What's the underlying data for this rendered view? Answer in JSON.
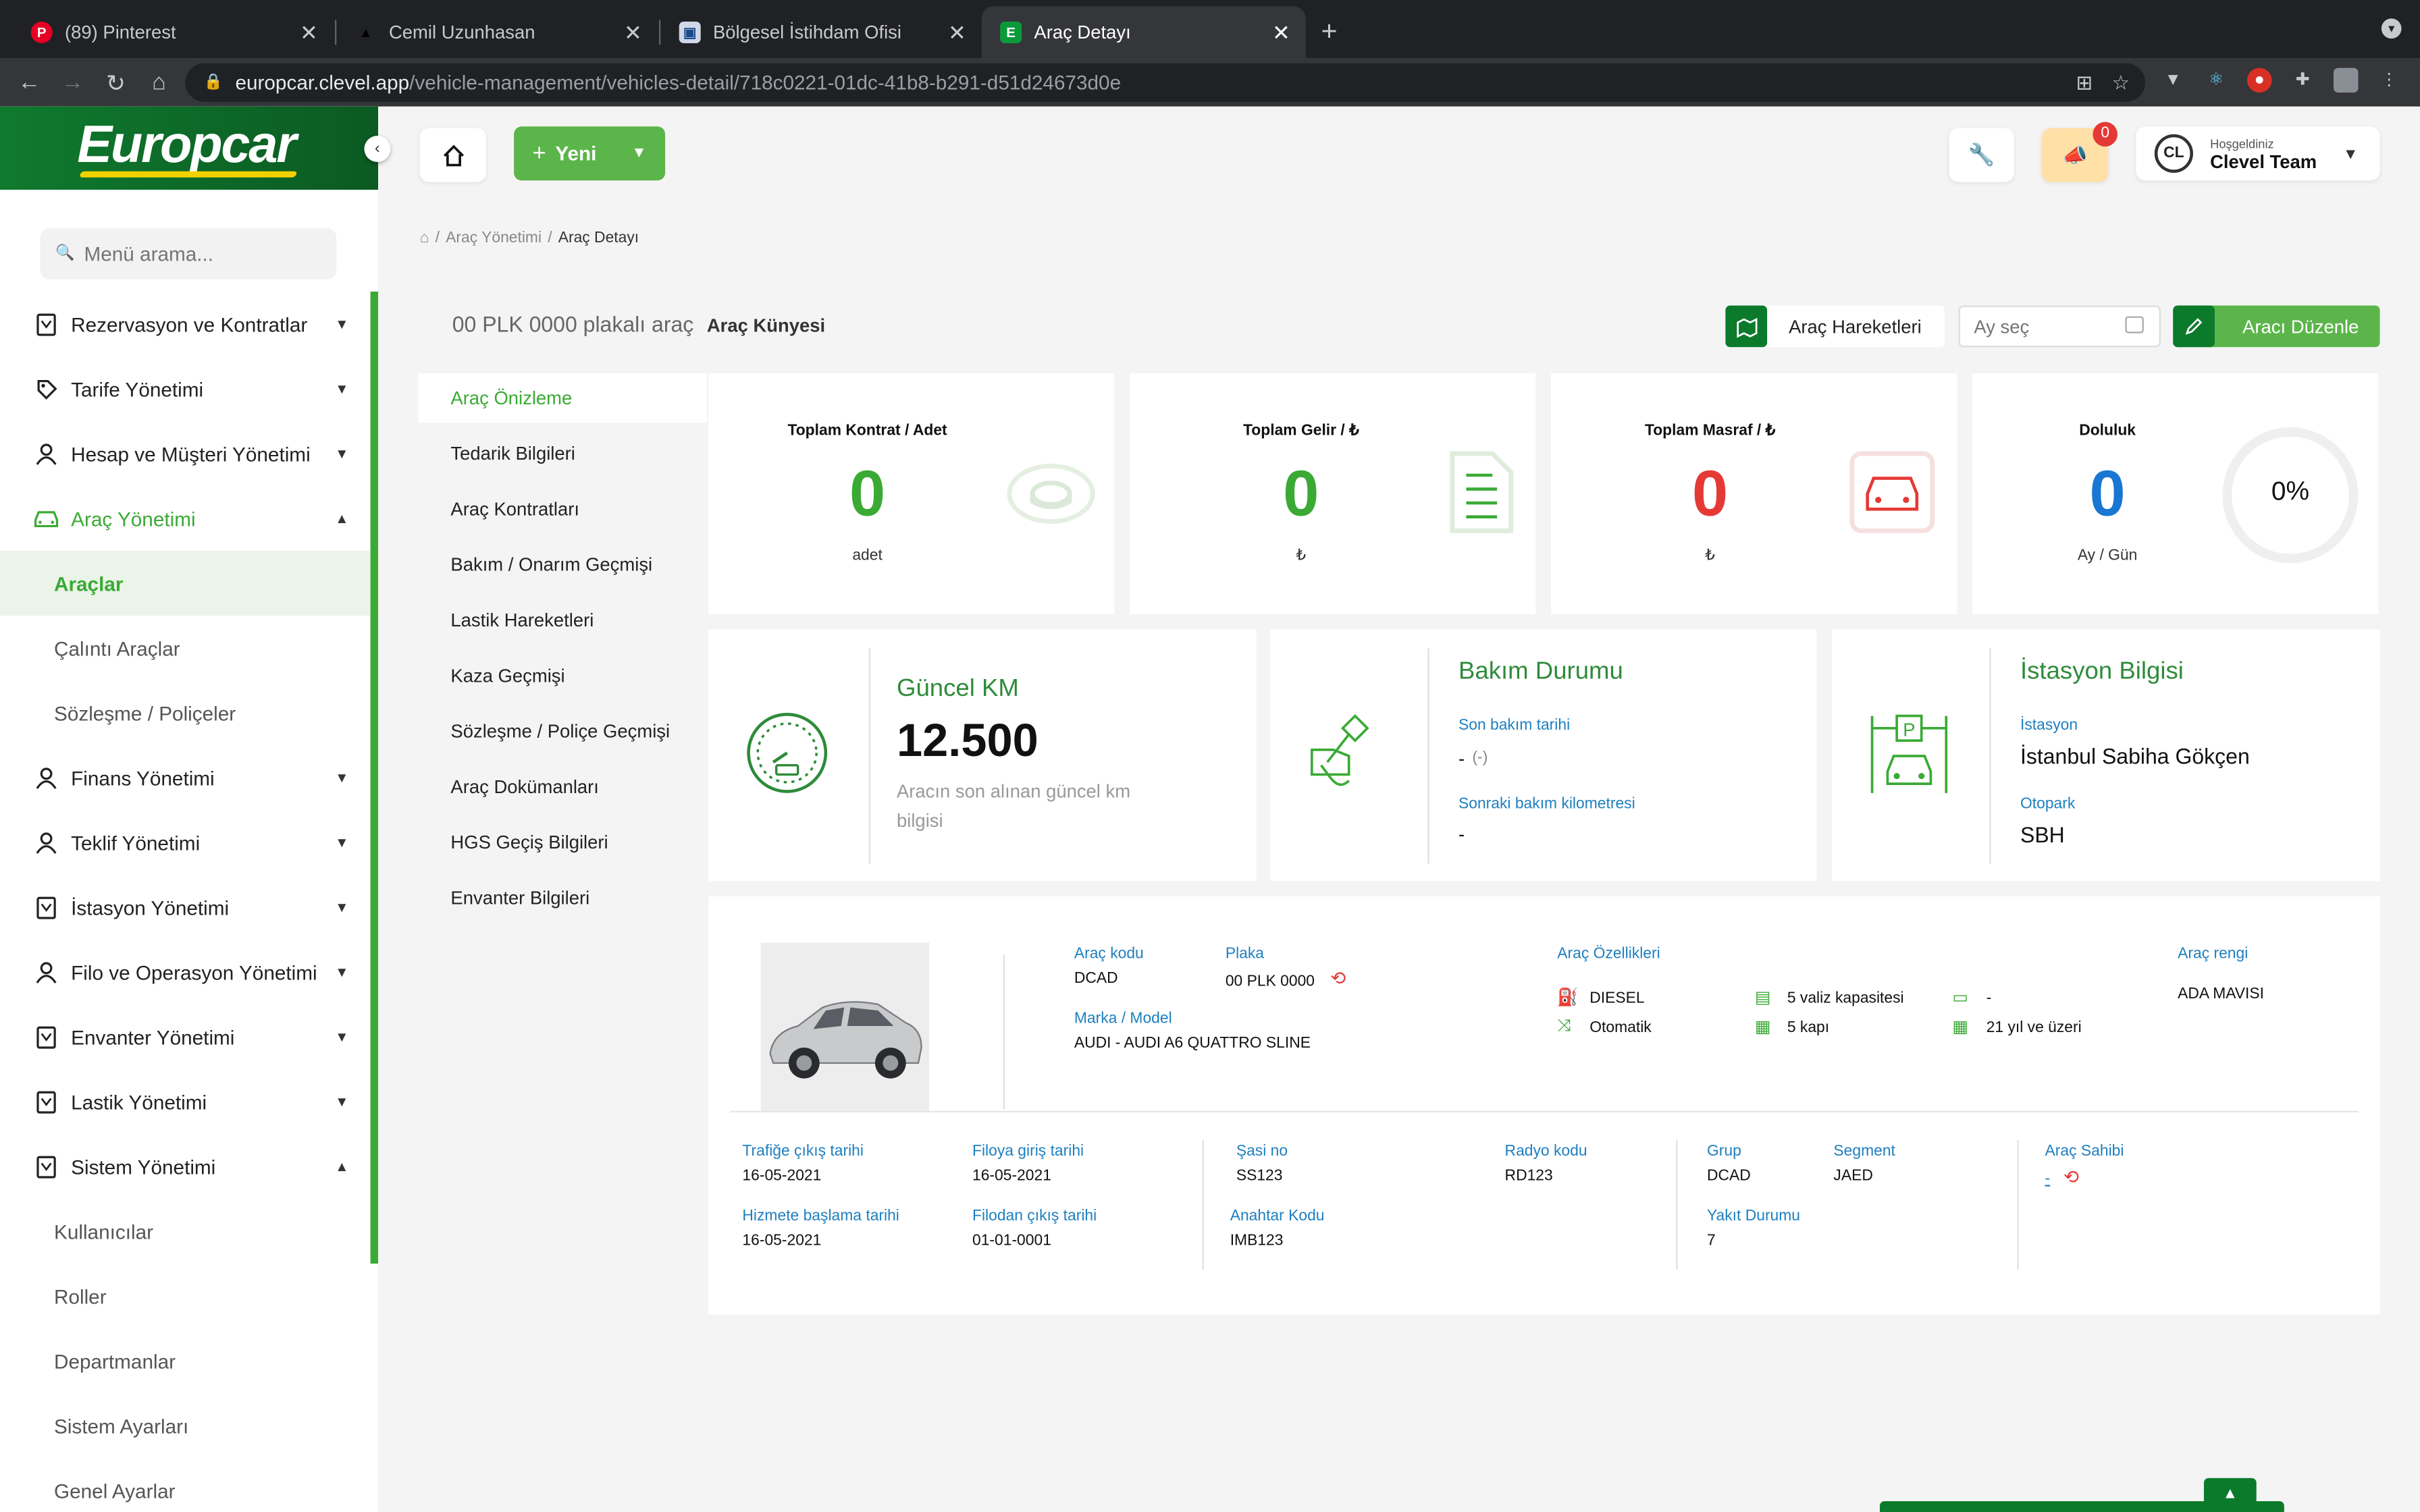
{
  "browser": {
    "tabs": [
      {
        "title": "(89) Pinterest"
      },
      {
        "title": "Cemil Uzunhasan"
      },
      {
        "title": "Bölgesel İstihdam Ofisi"
      },
      {
        "title": "Araç Detayı"
      }
    ],
    "url_domain": "europcar.clevel.app",
    "url_path": "/vehicle-management/vehicles-detail/718c0221-01dc-41b8-b291-d51d24673d0e"
  },
  "brand": {
    "logo": "Europcar",
    "primary": "#0b7a2b",
    "accent": "#5cb54a",
    "logo_stripe": "#f2d100"
  },
  "sidebar": {
    "search_placeholder": "Menü arama...",
    "items": [
      {
        "label": "Rezervasyon ve Kontratlar",
        "icon": "contract-icon",
        "chevron": "down"
      },
      {
        "label": "Tarife Yönetimi",
        "icon": "tag-icon",
        "chevron": "down"
      },
      {
        "label": "Hesap ve Müşteri Yönetimi",
        "icon": "user-icon",
        "chevron": "down"
      },
      {
        "label": "Araç Yönetimi",
        "icon": "car-icon",
        "chevron": "up"
      },
      {
        "label": "Araçlar"
      },
      {
        "label": "Çalıntı Araçlar"
      },
      {
        "label": "Sözleşme / Poliçeler"
      },
      {
        "label": "Finans Yönetimi",
        "icon": "user-icon",
        "chevron": "down"
      },
      {
        "label": "Teklif Yönetimi",
        "icon": "user-icon",
        "chevron": "down"
      },
      {
        "label": "İstasyon Yönetimi",
        "icon": "contract-icon",
        "chevron": "down"
      },
      {
        "label": "Filo ve Operasyon Yönetimi",
        "icon": "user-icon",
        "chevron": "down"
      },
      {
        "label": "Envanter Yönetimi",
        "icon": "contract-icon",
        "chevron": "down"
      },
      {
        "label": "Lastik Yönetimi",
        "icon": "contract-icon",
        "chevron": "down"
      },
      {
        "label": "Sistem Yönetimi",
        "icon": "contract-icon",
        "chevron": "up"
      },
      {
        "label": "Kullanıcılar"
      },
      {
        "label": "Roller"
      },
      {
        "label": "Departmanlar"
      },
      {
        "label": "Sistem Ayarları"
      },
      {
        "label": "Genel Ayarlar"
      }
    ]
  },
  "header": {
    "new_button": "Yeni",
    "notification_count": "0",
    "user_greeting": "Hoşgeldiniz",
    "user_name": "Clevel Team",
    "user_initials": "CL"
  },
  "breadcrumb": {
    "items": [
      "Araç Yönetimi",
      "Araç Detayı"
    ]
  },
  "page": {
    "title": "00 PLK 0000 plakalı araç",
    "subtitle": "Araç Künyesi",
    "movements_button": "Araç Hareketleri",
    "month_placeholder": "Ay seç",
    "edit_button": "Aracı Düzenle"
  },
  "detail_nav": {
    "items": [
      "Araç Önizleme",
      "Tedarik Bilgileri",
      "Araç Kontratları",
      "Bakım / Onarım Geçmişi",
      "Lastik Hareketleri",
      "Kaza Geçmişi",
      "Sözleşme / Poliçe Geçmişi",
      "Araç Dokümanları",
      "HGS Geçiş Bilgileri",
      "Envanter Bilgileri"
    ]
  },
  "stats": [
    {
      "label": "Toplam Kontrat / Adet",
      "value": "0",
      "unit": "adet",
      "color": "#3aaa35"
    },
    {
      "label": "Toplam Gelir / ₺",
      "value": "0",
      "unit": "₺",
      "color": "#3aaa35"
    },
    {
      "label": "Toplam Masraf / ₺",
      "value": "0",
      "unit": "₺",
      "color": "#e53935"
    },
    {
      "label": "Doluluk",
      "value": "0",
      "unit": "Ay / Gün",
      "color": "#1976d2",
      "percent": "0%"
    }
  ],
  "km_card": {
    "title": "Güncel KM",
    "value": "12.500",
    "desc": "Aracın son alınan güncel km bilgisi"
  },
  "maintenance_card": {
    "title": "Bakım Durumu",
    "last_label": "Son bakım tarihi",
    "last_value": "-",
    "last_extra": "(-)",
    "next_label": "Sonraki bakım kilometresi",
    "next_value": "-"
  },
  "station_card": {
    "title": "İstasyon Bilgisi",
    "station_label": "İstasyon",
    "station_value": "İstanbul Sabiha Gökçen",
    "park_label": "Otopark",
    "park_value": "SBH"
  },
  "vehicle": {
    "code_label": "Araç kodu",
    "code": "DCAD",
    "plate_label": "Plaka",
    "plate": "00 PLK 0000",
    "brand_label": "Marka / Model",
    "brand": "AUDI - AUDI A6 QUATTRO SLINE",
    "features_label": "Araç Özellikleri",
    "fuel": "DIESEL",
    "transmission": "Otomatik",
    "luggage": "5 valiz kapasitesi",
    "doors": "5 kapı",
    "license": "-",
    "age": "21 yıl ve üzeri",
    "color_label": "Araç rengi",
    "color": "ADA MAVISI",
    "traffic_label": "Trafiğe çıkış tarihi",
    "traffic": "16-05-2021",
    "fleet_in_label": "Filoya giriş tarihi",
    "fleet_in": "16-05-2021",
    "service_label": "Hizmete başlama tarihi",
    "service": "16-05-2021",
    "fleet_out_label": "Filodan çıkış tarihi",
    "fleet_out": "01-01-0001",
    "chassis_label": "Şasi no",
    "chassis": "SS123",
    "radio_label": "Radyo kodu",
    "radio": "RD123",
    "key_label": "Anahtar Kodu",
    "key": "IMB123",
    "group_label": "Grup",
    "group": "DCAD",
    "segment_label": "Segment",
    "segment": "JAED",
    "fuel_level_label": "Yakıt Durumu",
    "fuel_level": "7",
    "owner_label": "Araç Sahibi",
    "owner": "-"
  }
}
